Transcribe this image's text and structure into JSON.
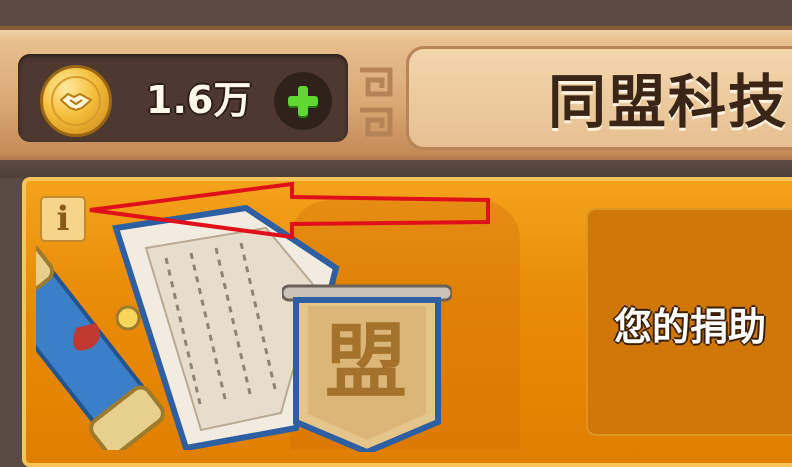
{
  "header": {
    "currency": {
      "icon": "alliance-coin-icon",
      "amount": "1.6万",
      "add_icon": "plus-icon"
    },
    "title": "同盟科技"
  },
  "main": {
    "info_icon_letter": "i",
    "emblem_char": "盟",
    "donate_label": "您的捐助"
  },
  "colors": {
    "panel_orange": "#e98c08",
    "header_tan": "#e6c091",
    "add_green": "#5fd82f",
    "annotation_red": "#e0101a"
  }
}
